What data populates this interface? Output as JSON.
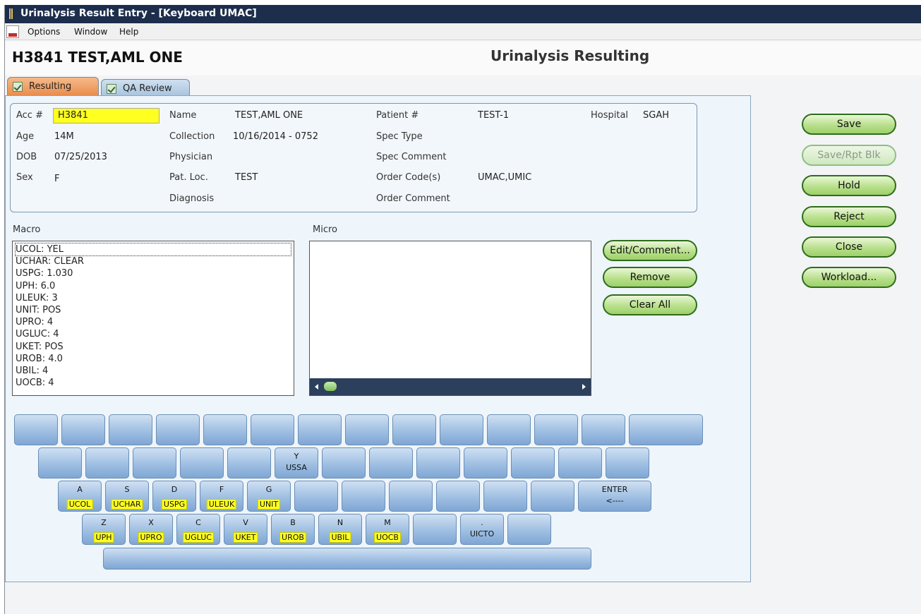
{
  "window": {
    "title": "Urinalysis Result Entry - [Keyboard UMAC]"
  },
  "menu": {
    "items": [
      "Options",
      "Window",
      "Help"
    ]
  },
  "header": {
    "patient_title": "H3841 TEST,AML ONE",
    "screen_title": "Urinalysis Resulting"
  },
  "tabs": [
    {
      "label": "Resulting",
      "checked": true,
      "active": true
    },
    {
      "label": "QA Review",
      "checked": true,
      "active": false
    }
  ],
  "patient": {
    "acc_label": "Acc #",
    "acc_value": "H3841",
    "age_label": "Age",
    "age_value": "14M",
    "dob_label": "DOB",
    "dob_value": "07/25/2013",
    "sex_label": "Sex",
    "sex_value": "F",
    "name_label": "Name",
    "name_value": "TEST,AML ONE",
    "collection_label": "Collection",
    "collection_value": "10/16/2014 - 0752",
    "physician_label": "Physician",
    "patloc_label": "Pat. Loc.",
    "patloc_value": "TEST",
    "diagnosis_label": "Diagnosis",
    "patientnum_label": "Patient #",
    "patientnum_value": "TEST-1",
    "spectype_label": "Spec Type",
    "speccomment_label": "Spec Comment",
    "ordercode_label": "Order Code(s)",
    "ordercode_value": "UMAC,UMIC",
    "ordercomment_label": "Order Comment",
    "hospital_label": "Hospital",
    "hospital_value": "SGAH"
  },
  "macro": {
    "label": "Macro",
    "items": [
      "UCOL:  YEL",
      "UCHAR:  CLEAR",
      "USPG:  1.030",
      "UPH:  6.0",
      "ULEUK:  3",
      "UNIT:  POS",
      "UPRO:  4",
      "UGLUC:  4",
      "UKET:  POS",
      "UROB:  4.0",
      "UBIL:  4",
      "UOCB:  4"
    ]
  },
  "micro": {
    "label": "Micro"
  },
  "actions": {
    "edit_comment": "Edit/Comment...",
    "remove": "Remove",
    "clear_all": "Clear All"
  },
  "side_buttons": {
    "save": "Save",
    "save_rpt_blk": "Save/Rpt Blk",
    "hold": "Hold",
    "reject": "Reject",
    "close": "Close",
    "workload": "Workload..."
  },
  "keyboard": {
    "y": {
      "key": "Y",
      "code": "USSA"
    },
    "a": {
      "key": "A",
      "code": "UCOL"
    },
    "s": {
      "key": "S",
      "code": "UCHAR"
    },
    "d": {
      "key": "D",
      "code": "USPG"
    },
    "f": {
      "key": "F",
      "code": "ULEUK"
    },
    "g": {
      "key": "G",
      "code": "UNIT"
    },
    "enter": {
      "key": "ENTER",
      "code": "<----"
    },
    "z": {
      "key": "Z",
      "code": "UPH"
    },
    "x": {
      "key": "X",
      "code": "UPRO"
    },
    "c": {
      "key": "C",
      "code": "UGLUC"
    },
    "v": {
      "key": "V",
      "code": "UKET"
    },
    "b": {
      "key": "B",
      "code": "UROB"
    },
    "n": {
      "key": "N",
      "code": "UBIL"
    },
    "m": {
      "key": "M",
      "code": "UOCB"
    },
    "period": {
      "key": ".",
      "code": "UICTO"
    }
  },
  "colors": {
    "titlebar": "#1d2d4c",
    "accent_green": "#2e6d1a",
    "highlight_yellow": "#ffff20",
    "tab_active": "#e88c4b",
    "key_blue": "#9fbfe2"
  }
}
